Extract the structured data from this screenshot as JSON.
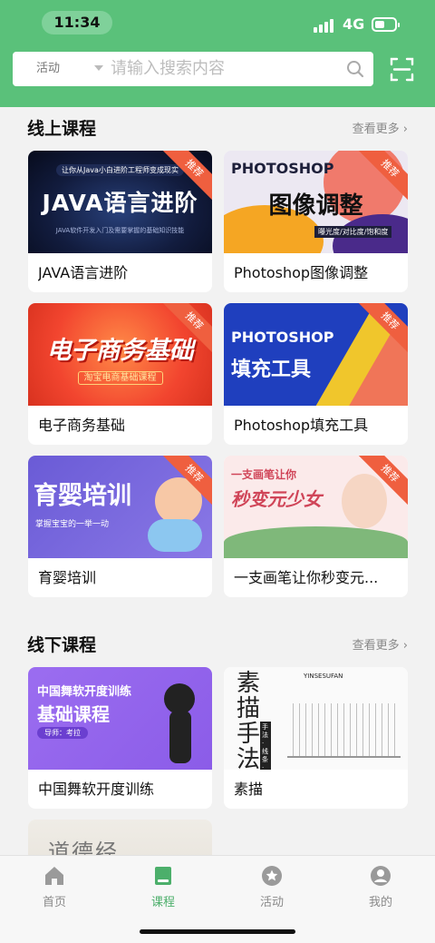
{
  "status_bar": {
    "time": "11:34",
    "network": "4G",
    "battery_level": 0.5
  },
  "search": {
    "type_label": "活动",
    "placeholder": "请输入搜索内容"
  },
  "icons": {
    "search": "search-icon",
    "scan": "scan-icon"
  },
  "online": {
    "title": "线上课程",
    "more": "查看更多",
    "courses": [
      {
        "title": "JAVA语言进阶",
        "badge": "推荐",
        "img_heading": "JAVA语言进阶",
        "img_sub": "让你从Java小白进阶工程师变成现实",
        "img_sub2": "JAVA软件开发入门及需要掌握的基础知识技能"
      },
      {
        "title": "Photoshop图像调整",
        "badge": "推荐",
        "img_heading": "PHOTOSHOP",
        "img_heading2": "图像调整",
        "img_sub": "曝光度/对比度/饱和度"
      },
      {
        "title": "电子商务基础",
        "badge": "推荐",
        "img_heading": "电子商务基础",
        "img_sub": "淘宝电商基础课程"
      },
      {
        "title": "Photoshop填充工具",
        "badge": "推荐",
        "img_heading": "PHOTOSHOP",
        "img_heading2": "填充工具"
      },
      {
        "title": "育婴培训",
        "badge": "推荐",
        "img_heading": "育婴培训",
        "img_sub": "掌握宝宝的一举一动"
      },
      {
        "title": "一支画笔让你秒变元...",
        "badge": "推荐",
        "img_heading": "一支画笔让你",
        "img_heading2": "秒变元少女"
      }
    ]
  },
  "offline": {
    "title": "线下课程",
    "more": "查看更多",
    "courses": [
      {
        "title": "中国舞软开度训练",
        "img_heading": "中国舞软开度训练",
        "img_heading2": "基础课程",
        "img_sub": "导师：考拉"
      },
      {
        "title": "素描",
        "img_heading": "素描手法",
        "img_sub": "手法·线条·色调",
        "img_sub2": "YINSESUFAN"
      },
      {
        "title": "",
        "img_heading": "道德经"
      }
    ]
  },
  "tabbar": {
    "items": [
      {
        "label": "首页",
        "icon": "home-icon"
      },
      {
        "label": "课程",
        "icon": "book-icon",
        "active": true
      },
      {
        "label": "活动",
        "icon": "star-icon"
      },
      {
        "label": "我的",
        "icon": "user-icon"
      }
    ]
  },
  "colors": {
    "brand_green": "#5ac17a",
    "active_tab": "#4caf6b",
    "badge_red": "#ef5f3f"
  }
}
